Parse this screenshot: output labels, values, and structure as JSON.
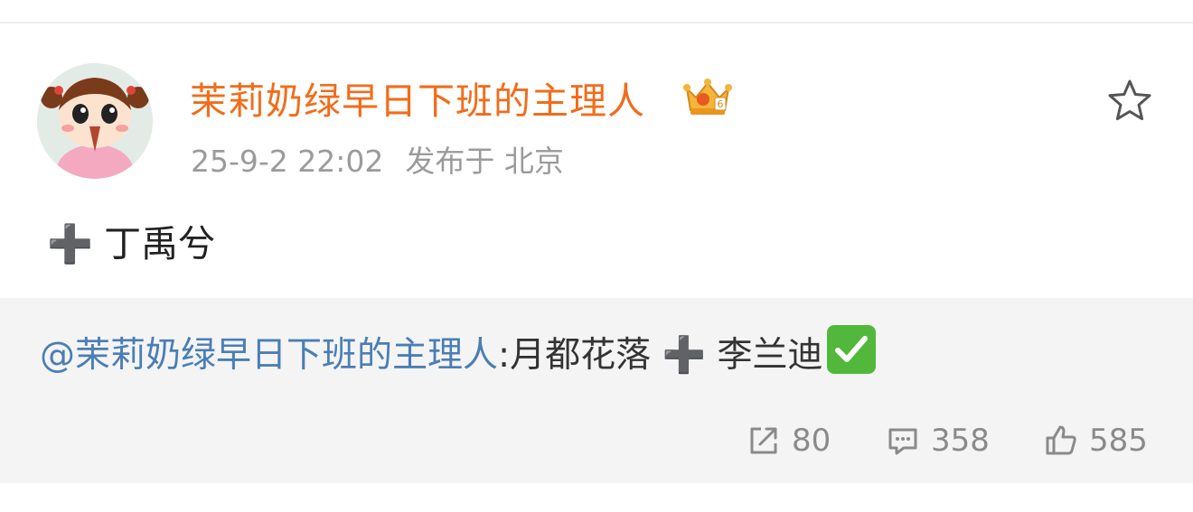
{
  "post": {
    "username": "茉莉奶绿早日下班的主理人",
    "badge_icon": "crown-badge-icon",
    "timestamp": "25-9-2 22:02",
    "location": "发布于 北京",
    "content_prefix": "➕",
    "content_text": "丁禹兮"
  },
  "repost": {
    "mention": "@茉莉奶绿早日下班的主理人",
    "text": ":月都花落 ➕ 李兰迪",
    "check_icon": "check-mark-icon",
    "stats": {
      "reposts": "80",
      "comments": "358",
      "likes": "585"
    }
  },
  "colors": {
    "username": "#f26c1a",
    "mention": "#4a7eb5",
    "repost_bg": "#f4f4f4",
    "meta": "#9b9b9b",
    "check_bg": "#51b83c"
  }
}
